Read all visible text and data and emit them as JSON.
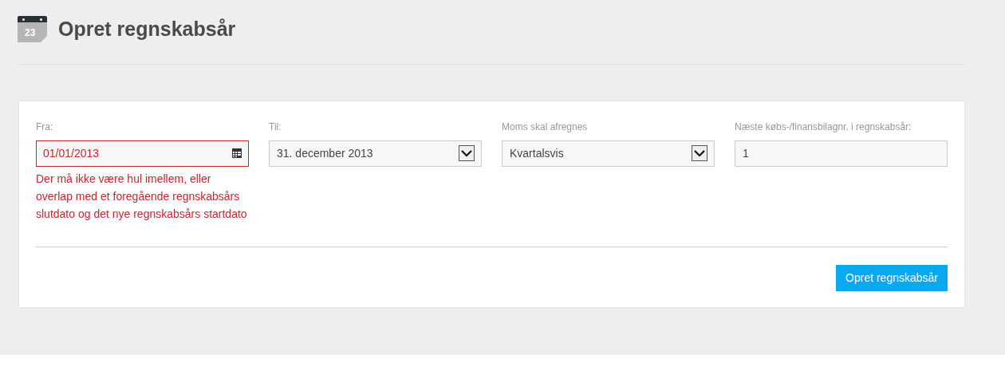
{
  "header": {
    "icon_label": "23",
    "title": "Opret regnskabsår"
  },
  "fields": [
    {
      "kind": "date",
      "label": "Fra:",
      "value": "01/01/2013",
      "error": true,
      "error_text": "Der må ikke være hul imellem, eller overlap med et foregående regnskabsårs slutdato og det nye regnskabsårs startdato"
    },
    {
      "kind": "select",
      "label": "Til:",
      "value": "31. december 2013",
      "error": false
    },
    {
      "kind": "select",
      "label": "Moms skal afregnes",
      "value": "Kvartalsvis",
      "error": false
    },
    {
      "kind": "text",
      "label": "Næste købs-/finansbilagnr. i regnskabsår:",
      "value": "1",
      "error": false
    }
  ],
  "submit": "Opret regnskabsår"
}
